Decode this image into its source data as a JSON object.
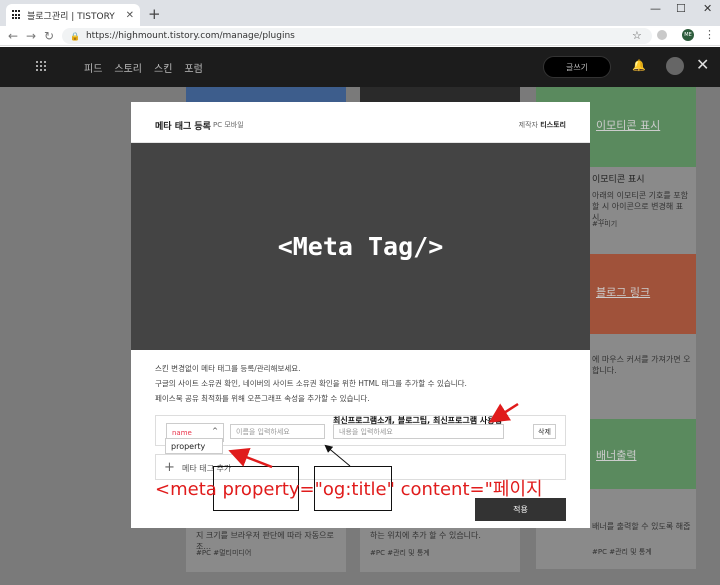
{
  "browser": {
    "tab_title": "블로그관리 | TISTORY",
    "tab_close": "✕",
    "new_tab": "+",
    "minimize": "—",
    "maximize": "☐",
    "close": "✕",
    "url": "https://highmount.tistory.com/manage/plugins",
    "profile_initials": "ME"
  },
  "site": {
    "nav": [
      "피드",
      "스토리",
      "스킨",
      "포럼"
    ],
    "write_button": "글쓰기"
  },
  "background_cards": {
    "right_top_title": "이모티콘 표시",
    "right_top_heading": "이모티콘 표시",
    "right_top_text_1": "아래의 이모티콘 기호를 포함",
    "right_top_text_2": "할 시 아이콘으로 변경해 표시...",
    "right_top_tag": "#꾸미기",
    "right_mid_title": "블로그 링크",
    "right_mid_text_1": "에 마우스 커서를 가져가면 오",
    "right_mid_text_2": "합니다.",
    "right_low_title": "배너출력",
    "right_low_text": "배너를 출력할 수 있도록 해줍",
    "left_bottom_text": "지 크기를 브라우저 판단에 따라 자동으로 조...",
    "left_bottom_tag": "#PC  #멀티미디어",
    "mid_bottom_text": "하는 위치에 추가 할 수 있습니다.",
    "mid_bottom_tag": "#PC  #관리 및 통계",
    "right_bottom_tag": "#PC  #관리 및 통계"
  },
  "modal": {
    "title": "메타 태그 등록",
    "subtitle": "PC 모바일",
    "maker_label": "제작자",
    "maker_name": "티스토리",
    "hero_text": "<Meta Tag/>",
    "desc_1": "스킨 변경없이 메타 태그를 등록/관리해보세요.",
    "desc_2": "구글의 사이트 소유권 확인, 네이버의 사이트 소유권 확인을 위한 HTML 태그를 추가할 수 있습니다.",
    "desc_3": "페이스북 공유 최적화를 위해 오픈그래프 속성을 추가할 수 있습니다.",
    "select_value": "name",
    "dropdown_option": "property",
    "name_placeholder": "이름을 입력하세요",
    "content_placeholder": "내용을 입력하세요",
    "delete_button": "삭제",
    "add_label": "메타 태그 추가",
    "apply_button": "적용"
  },
  "annotations": {
    "note": "최신프로그램소개, 블로그팁, 최신프로그램 사용법",
    "code": "<meta property=\"og:title\" content=\"페이지"
  },
  "colors": {
    "annotation_red": "#e01b1b",
    "select_red": "#e9334a",
    "hero_bg": "#444444"
  }
}
